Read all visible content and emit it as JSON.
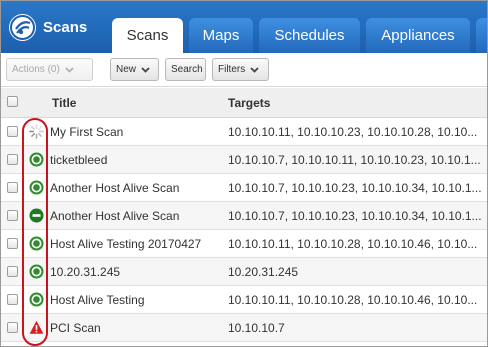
{
  "header": {
    "app_name": "Scans",
    "tabs": [
      {
        "label": "Scans",
        "active": true
      },
      {
        "label": "Maps",
        "active": false
      },
      {
        "label": "Schedules",
        "active": false
      },
      {
        "label": "Appliances",
        "active": false
      }
    ]
  },
  "toolbar": {
    "actions_label": "Actions (0)",
    "new_label": "New",
    "search_label": "Search",
    "filters_label": "Filters"
  },
  "table": {
    "columns": {
      "title": "Title",
      "targets": "Targets"
    },
    "rows": [
      {
        "status": "running",
        "title": "My First Scan",
        "targets": "10.10.10.11, 10.10.10.23, 10.10.10.28, 10.10..."
      },
      {
        "status": "finished",
        "title": "ticketbleed",
        "targets": "10.10.10.7, 10.10.10.11, 10.10.10.23, 10.10.1..."
      },
      {
        "status": "finished",
        "title": "Another Host Alive Scan",
        "targets": "10.10.10.7, 10.10.10.23, 10.10.10.34, 10.10.1..."
      },
      {
        "status": "canceled",
        "title": "Another Host Alive Scan",
        "targets": "10.10.10.7, 10.10.10.23, 10.10.10.34, 10.10.1..."
      },
      {
        "status": "finished",
        "title": "Host Alive Testing 20170427",
        "targets": "10.10.10.11, 10.10.10.28, 10.10.10.46, 10.10..."
      },
      {
        "status": "finished",
        "title": "10.20.31.245",
        "targets": "10.20.31.245"
      },
      {
        "status": "finished",
        "title": "Host Alive Testing",
        "targets": "10.10.10.11, 10.10.10.28, 10.10.10.46, 10.10..."
      },
      {
        "status": "error",
        "title": "PCI Scan",
        "targets": "10.10.10.7"
      }
    ]
  },
  "colors": {
    "header_blue": "#1d5fae",
    "status_green": "#2e8b2e",
    "status_error": "#d42020",
    "highlight_red": "#c8141e"
  }
}
